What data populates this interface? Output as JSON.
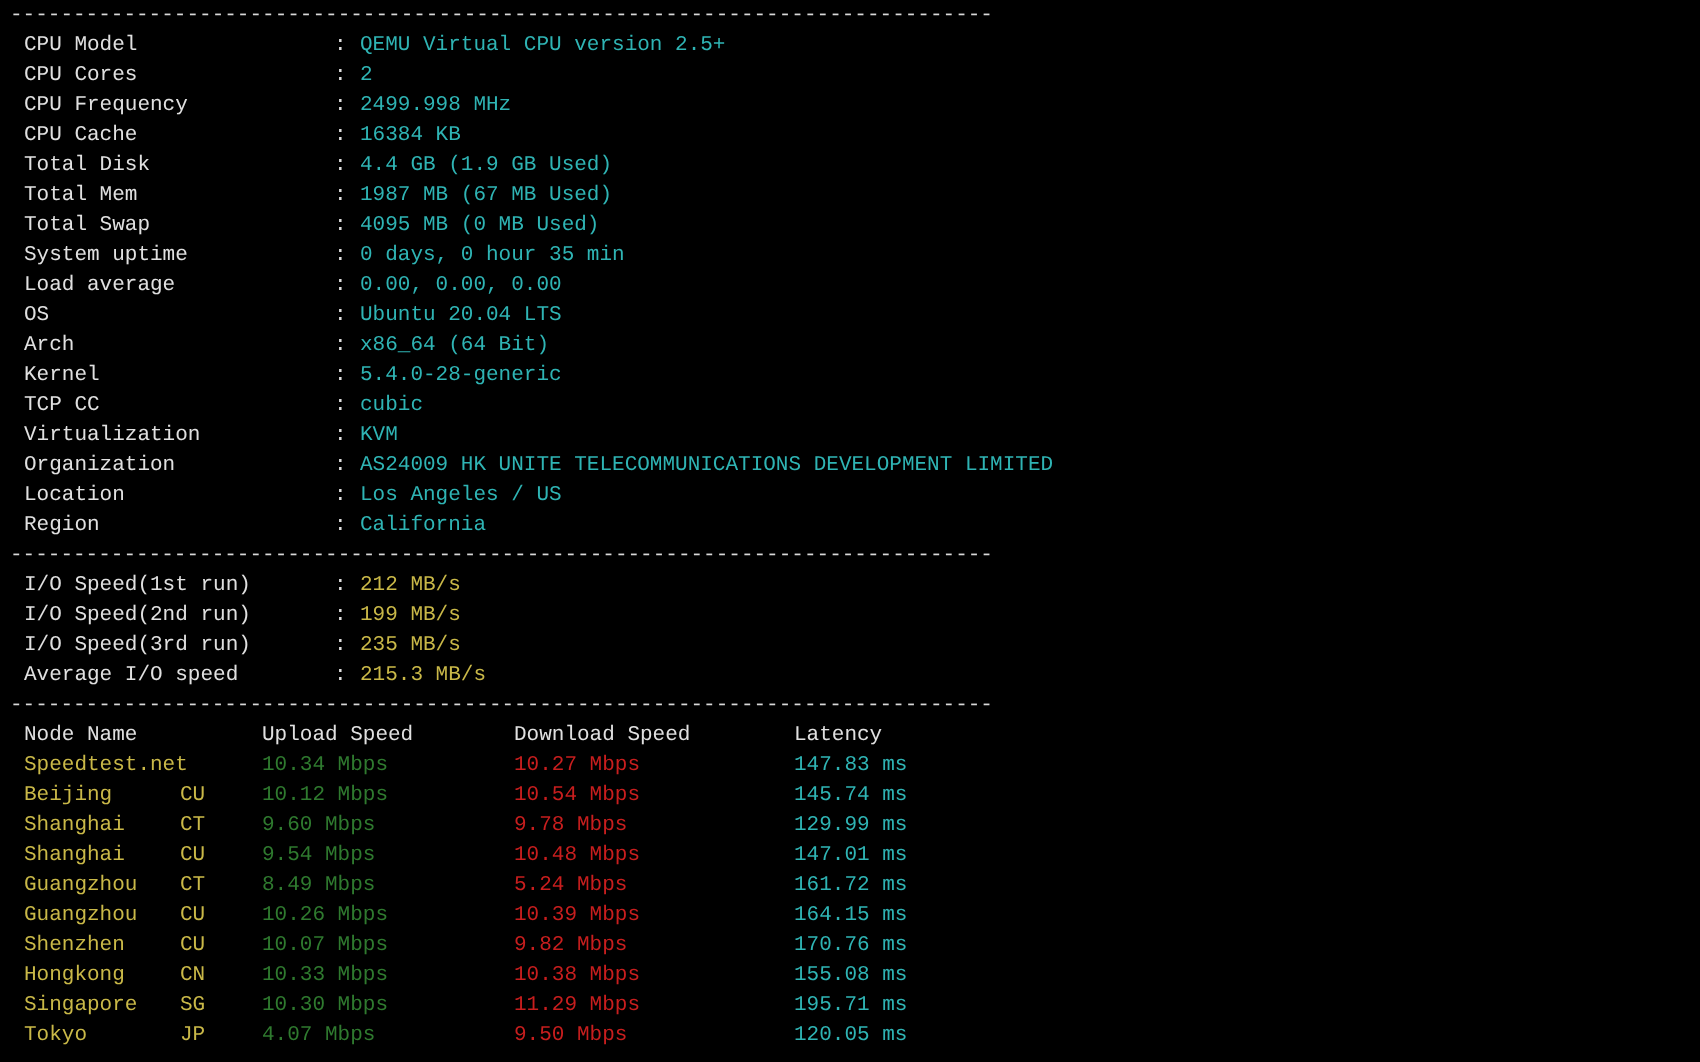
{
  "separators": [
    "------------------------------------------------------------------------------",
    "------------------------------------------------------------------------------",
    "------------------------------------------------------------------------------"
  ],
  "system_info": [
    {
      "label": "CPU Model",
      "colon": ":",
      "value": "QEMU Virtual CPU version 2.5+"
    },
    {
      "label": "CPU Cores",
      "colon": ":",
      "value": "2"
    },
    {
      "label": "CPU Frequency",
      "colon": ":",
      "value": "2499.998 MHz"
    },
    {
      "label": "CPU Cache",
      "colon": ":",
      "value": "16384 KB"
    },
    {
      "label": "Total Disk",
      "colon": ":",
      "value": "4.4 GB (1.9 GB Used)"
    },
    {
      "label": "Total Mem",
      "colon": ":",
      "value": "1987 MB (67 MB Used)"
    },
    {
      "label": "Total Swap",
      "colon": ":",
      "value": "4095 MB (0 MB Used)"
    },
    {
      "label": "System uptime",
      "colon": ":",
      "value": "0 days, 0 hour 35 min"
    },
    {
      "label": "Load average",
      "colon": ":",
      "value": "0.00, 0.00, 0.00"
    },
    {
      "label": "OS",
      "colon": ":",
      "value": "Ubuntu 20.04 LTS"
    },
    {
      "label": "Arch",
      "colon": ":",
      "value": "x86_64 (64 Bit)"
    },
    {
      "label": "Kernel",
      "colon": ":",
      "value": "5.4.0-28-generic"
    },
    {
      "label": "TCP CC",
      "colon": ":",
      "value": "cubic"
    },
    {
      "label": "Virtualization",
      "colon": ":",
      "value": "KVM"
    },
    {
      "label": "Organization",
      "colon": ":",
      "value": "AS24009 HK UNITE TELECOMMUNICATIONS DEVELOPMENT LIMITED"
    },
    {
      "label": "Location",
      "colon": ":",
      "value": "Los Angeles / US"
    },
    {
      "label": "Region",
      "colon": ":",
      "value": "California"
    }
  ],
  "io_speed": [
    {
      "label": "I/O Speed(1st run)",
      "colon": ":",
      "value": "212 MB/s"
    },
    {
      "label": "I/O Speed(2nd run)",
      "colon": ":",
      "value": "199 MB/s"
    },
    {
      "label": "I/O Speed(3rd run)",
      "colon": ":",
      "value": "235 MB/s"
    },
    {
      "label": "Average I/O speed",
      "colon": ":",
      "value": "215.3 MB/s"
    }
  ],
  "speed_table": {
    "columns": [
      "Node Name",
      "Upload Speed",
      "Download Speed",
      "Latency"
    ],
    "rows": [
      {
        "node": "Speedtest.net",
        "isp": "",
        "upload": "10.34 Mbps",
        "download": "10.27 Mbps",
        "latency": "147.83 ms"
      },
      {
        "node": "Beijing",
        "isp": "CU",
        "upload": "10.12 Mbps",
        "download": "10.54 Mbps",
        "latency": "145.74 ms"
      },
      {
        "node": "Shanghai",
        "isp": "CT",
        "upload": "9.60 Mbps",
        "download": "9.78 Mbps",
        "latency": "129.99 ms"
      },
      {
        "node": "Shanghai",
        "isp": "CU",
        "upload": "9.54 Mbps",
        "download": "10.48 Mbps",
        "latency": "147.01 ms"
      },
      {
        "node": "Guangzhou",
        "isp": "CT",
        "upload": "8.49 Mbps",
        "download": "5.24 Mbps",
        "latency": "161.72 ms"
      },
      {
        "node": "Guangzhou",
        "isp": "CU",
        "upload": "10.26 Mbps",
        "download": "10.39 Mbps",
        "latency": "164.15 ms"
      },
      {
        "node": "Shenzhen",
        "isp": "CU",
        "upload": "10.07 Mbps",
        "download": "9.82 Mbps",
        "latency": "170.76 ms"
      },
      {
        "node": "Hongkong",
        "isp": "CN",
        "upload": "10.33 Mbps",
        "download": "10.38 Mbps",
        "latency": "155.08 ms"
      },
      {
        "node": "Singapore",
        "isp": "SG",
        "upload": "10.30 Mbps",
        "download": "11.29 Mbps",
        "latency": "195.71 ms"
      },
      {
        "node": "Tokyo",
        "isp": "JP",
        "upload": "4.07 Mbps",
        "download": "9.50 Mbps",
        "latency": "120.05 ms"
      }
    ]
  }
}
